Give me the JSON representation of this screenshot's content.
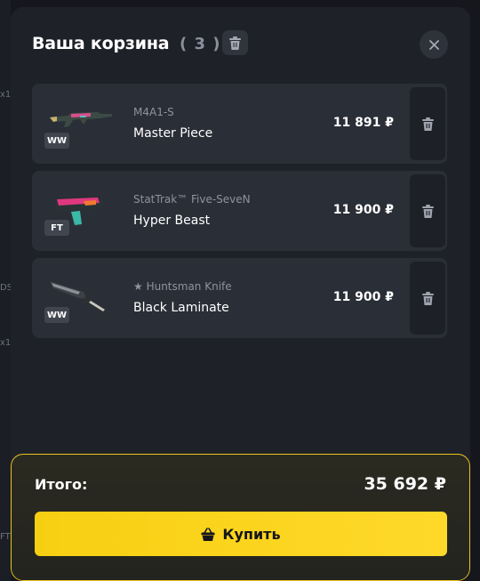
{
  "header": {
    "title": "Ваша корзина",
    "count": "( 3 )"
  },
  "items": [
    {
      "type": "M4A1-S",
      "name": "Master Piece",
      "wear": "WW",
      "price": "11 891 ₽"
    },
    {
      "type": "StatTrak™ Five-SeveN",
      "name": "Hyper Beast",
      "wear": "FT",
      "price": "11 900 ₽"
    },
    {
      "type": "★ Huntsman Knife",
      "name": "Black Laminate",
      "wear": "WW",
      "price": "11 900 ₽"
    }
  ],
  "footer": {
    "total_label": "Итого:",
    "total_value": "35 692 ₽",
    "buy_label": "Купить"
  },
  "background": {
    "t1": "x1",
    "t2": "x1",
    "t3": "DS",
    "t4": "FT"
  },
  "colors": {
    "accent": "#ffd31a",
    "panel": "#1e2127",
    "card": "#2a2e36"
  },
  "icons": [
    "trash-icon",
    "close-icon",
    "basket-icon"
  ]
}
